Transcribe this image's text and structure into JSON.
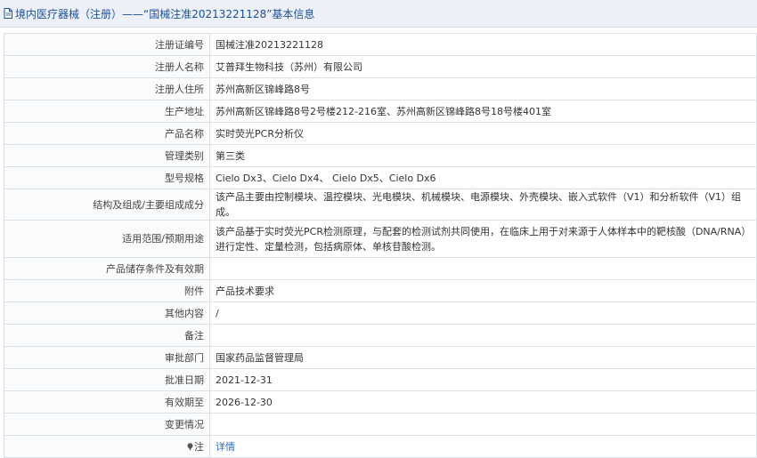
{
  "header": {
    "title": "境内医疗器械（注册）——“国械注准20213221128”基本信息"
  },
  "rows": [
    {
      "label": "注册证编号",
      "value": "国械注准20213221128"
    },
    {
      "label": "注册人名称",
      "value": "艾普拜生物科技（苏州）有限公司"
    },
    {
      "label": "注册人住所",
      "value": "苏州高新区锦峰路8号"
    },
    {
      "label": "生产地址",
      "value": "苏州高新区锦峰路8号2号楼212-216室、苏州高新区锦峰路8号18号楼401室"
    },
    {
      "label": "产品名称",
      "value": "实时荧光PCR分析仪"
    },
    {
      "label": "管理类别",
      "value": "第三类"
    },
    {
      "label": "型号规格",
      "value": "Cielo Dx3、Cielo Dx4、 Cielo Dx5、Cielo Dx6"
    },
    {
      "label": "结构及组成/主要组成成分",
      "value": "该产品主要由控制模块、温控模块、光电模块、机械模块、电源模块、外壳模块、嵌入式软件（V1）和分析软件（V1）组成。"
    },
    {
      "label": "适用范围/预期用途",
      "value": "该产品基于实时荧光PCR检测原理，与配套的检测试剂共同使用，在临床上用于对来源于人体样本中的靶核酸（DNA/RNA）进行定性、定量检测，包括病原体、单核苷酸检测。"
    },
    {
      "label": "产品储存条件及有效期",
      "value": ""
    },
    {
      "label": "附件",
      "value": "产品技术要求"
    },
    {
      "label": "其他内容",
      "value": "/"
    },
    {
      "label": "备注",
      "value": ""
    },
    {
      "label": "审批部门",
      "value": "国家药品监督管理局"
    },
    {
      "label": "批准日期",
      "value": "2021-12-31"
    },
    {
      "label": "有效期至",
      "value": "2026-12-30"
    },
    {
      "label": "变更情况",
      "value": ""
    }
  ],
  "note_row": {
    "label": "注",
    "link": "详情"
  }
}
